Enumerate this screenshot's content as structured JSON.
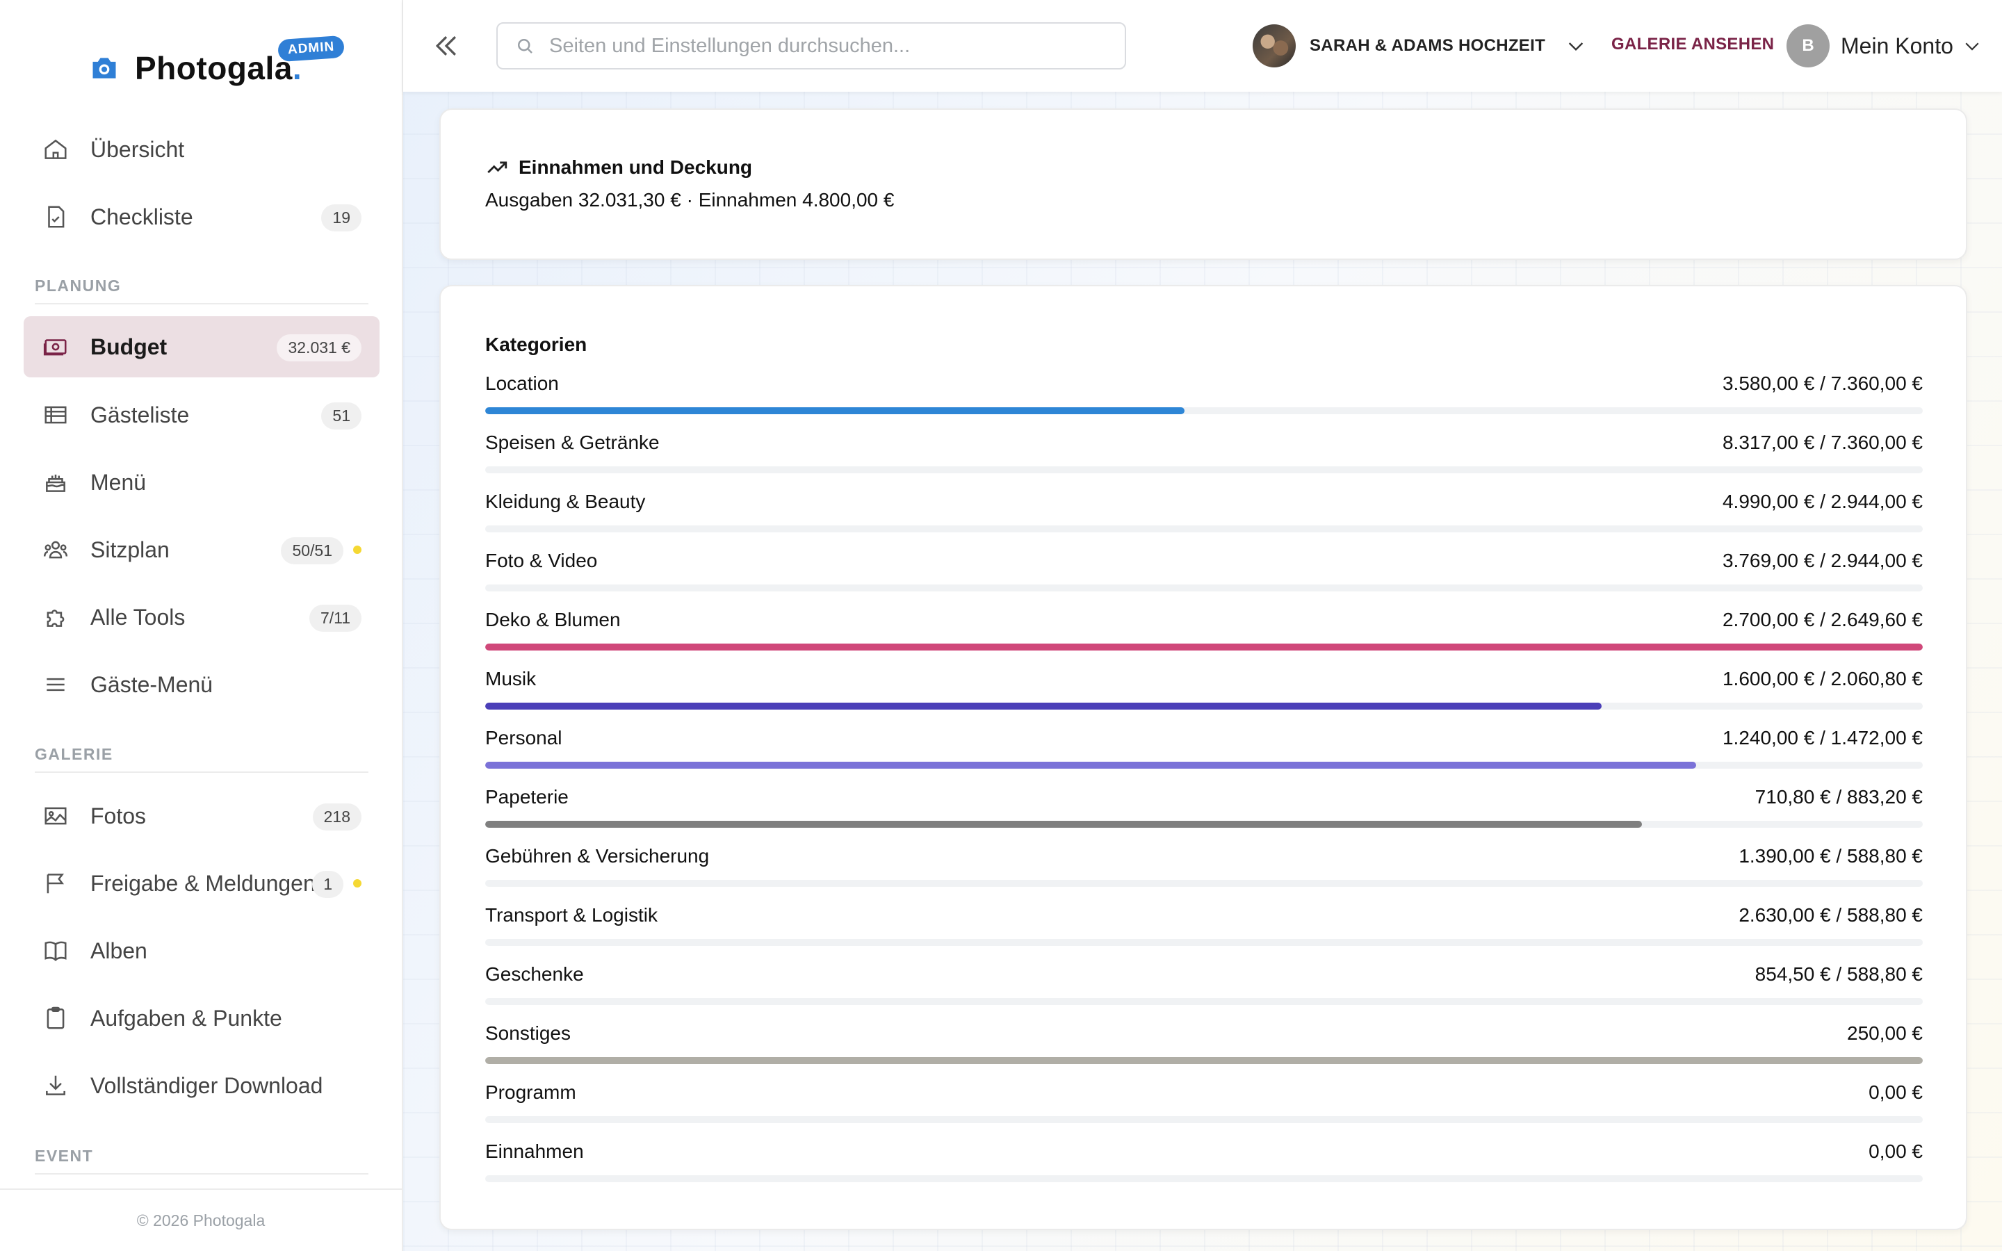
{
  "brand": {
    "name": "Photogala",
    "dot": ".",
    "badge": "ADMIN",
    "accent": "#2f7fd6"
  },
  "sidebar": {
    "items": [
      {
        "id": "uebersicht",
        "label": "Übersicht",
        "icon": "home-icon"
      },
      {
        "id": "checkliste",
        "label": "Checkliste",
        "icon": "checklist-icon",
        "badge": "19"
      },
      {
        "id": "budget",
        "label": "Budget",
        "icon": "money-icon",
        "badge": "32.031 €",
        "active": true
      },
      {
        "id": "gaesteliste",
        "label": "Gästeliste",
        "icon": "table-icon",
        "badge": "51"
      },
      {
        "id": "menue",
        "label": "Menü",
        "icon": "cake-icon"
      },
      {
        "id": "sitzplan",
        "label": "Sitzplan",
        "icon": "people-icon",
        "badge": "50/51",
        "dot": true
      },
      {
        "id": "alle-tools",
        "label": "Alle Tools",
        "icon": "puzzle-icon",
        "badge": "7/11"
      },
      {
        "id": "gaeste-menue",
        "label": "Gäste-Menü",
        "icon": "hamburger-icon"
      },
      {
        "id": "fotos",
        "label": "Fotos",
        "icon": "image-icon",
        "badge": "218"
      },
      {
        "id": "freigabe",
        "label": "Freigabe & Meldungen",
        "icon": "flag-icon",
        "badge": "1",
        "dot": true
      },
      {
        "id": "alben",
        "label": "Alben",
        "icon": "book-icon"
      },
      {
        "id": "aufgaben",
        "label": "Aufgaben & Punkte",
        "icon": "clipboard-icon"
      },
      {
        "id": "download",
        "label": "Vollständiger Download",
        "icon": "download-icon"
      }
    ],
    "sections": {
      "planung": "PLANUNG",
      "galerie": "GALERIE",
      "event": "EVENT"
    },
    "footer": "© 2026 Photogala"
  },
  "topbar": {
    "search_placeholder": "Seiten und Einstellungen durchsuchen...",
    "event_name": "SARAH & ADAMS HOCHZEIT",
    "gallery_link": "GALERIE ANSEHEN",
    "account_initial": "B",
    "account_label": "Mein Konto"
  },
  "summary": {
    "title": "Einnahmen und Deckung",
    "text": "Ausgaben 32.031,30 € · Einnahmen 4.800,00 €"
  },
  "categories": {
    "heading": "Kategorien",
    "rows": [
      {
        "name": "Location",
        "amount": "3.580,00 € / 7.360,00 €",
        "fill": 0.4865,
        "color": "#2e86d6"
      },
      {
        "name": "Speisen & Getränke",
        "amount": "8.317,00 € / 7.360,00 €",
        "fill": 0,
        "color": "#2e86d6"
      },
      {
        "name": "Kleidung & Beauty",
        "amount": "4.990,00 € / 2.944,00 €",
        "fill": 0,
        "color": "#2e86d6"
      },
      {
        "name": "Foto & Video",
        "amount": "3.769,00 € / 2.944,00 €",
        "fill": 0,
        "color": "#2e86d6"
      },
      {
        "name": "Deko & Blumen",
        "amount": "2.700,00 € / 2.649,60 €",
        "fill": 1.0,
        "color": "#d0487a"
      },
      {
        "name": "Musik",
        "amount": "1.600,00 € / 2.060,80 €",
        "fill": 0.7764,
        "color": "#4b3fb8"
      },
      {
        "name": "Personal",
        "amount": "1.240,00 € / 1.472,00 €",
        "fill": 0.8424,
        "color": "#7b72d8"
      },
      {
        "name": "Papeterie",
        "amount": "710,80 € / 883,20 €",
        "fill": 0.8048,
        "color": "#7f7f7f"
      },
      {
        "name": "Gebühren & Versicherung",
        "amount": "1.390,00 € / 588,80 €",
        "fill": 0,
        "color": "#2e86d6"
      },
      {
        "name": "Transport & Logistik",
        "amount": "2.630,00 € / 588,80 €",
        "fill": 0,
        "color": "#2e86d6"
      },
      {
        "name": "Geschenke",
        "amount": "854,50 € / 588,80 €",
        "fill": 0,
        "color": "#2e86d6"
      },
      {
        "name": "Sonstiges",
        "amount": "250,00 €",
        "fill": 1.0,
        "color": "#b0aea6"
      },
      {
        "name": "Programm",
        "amount": "0,00 €",
        "fill": 0,
        "color": "#2e86d6"
      },
      {
        "name": "Einnahmen",
        "amount": "0,00 €",
        "fill": 0,
        "color": "#2e86d6"
      }
    ]
  }
}
